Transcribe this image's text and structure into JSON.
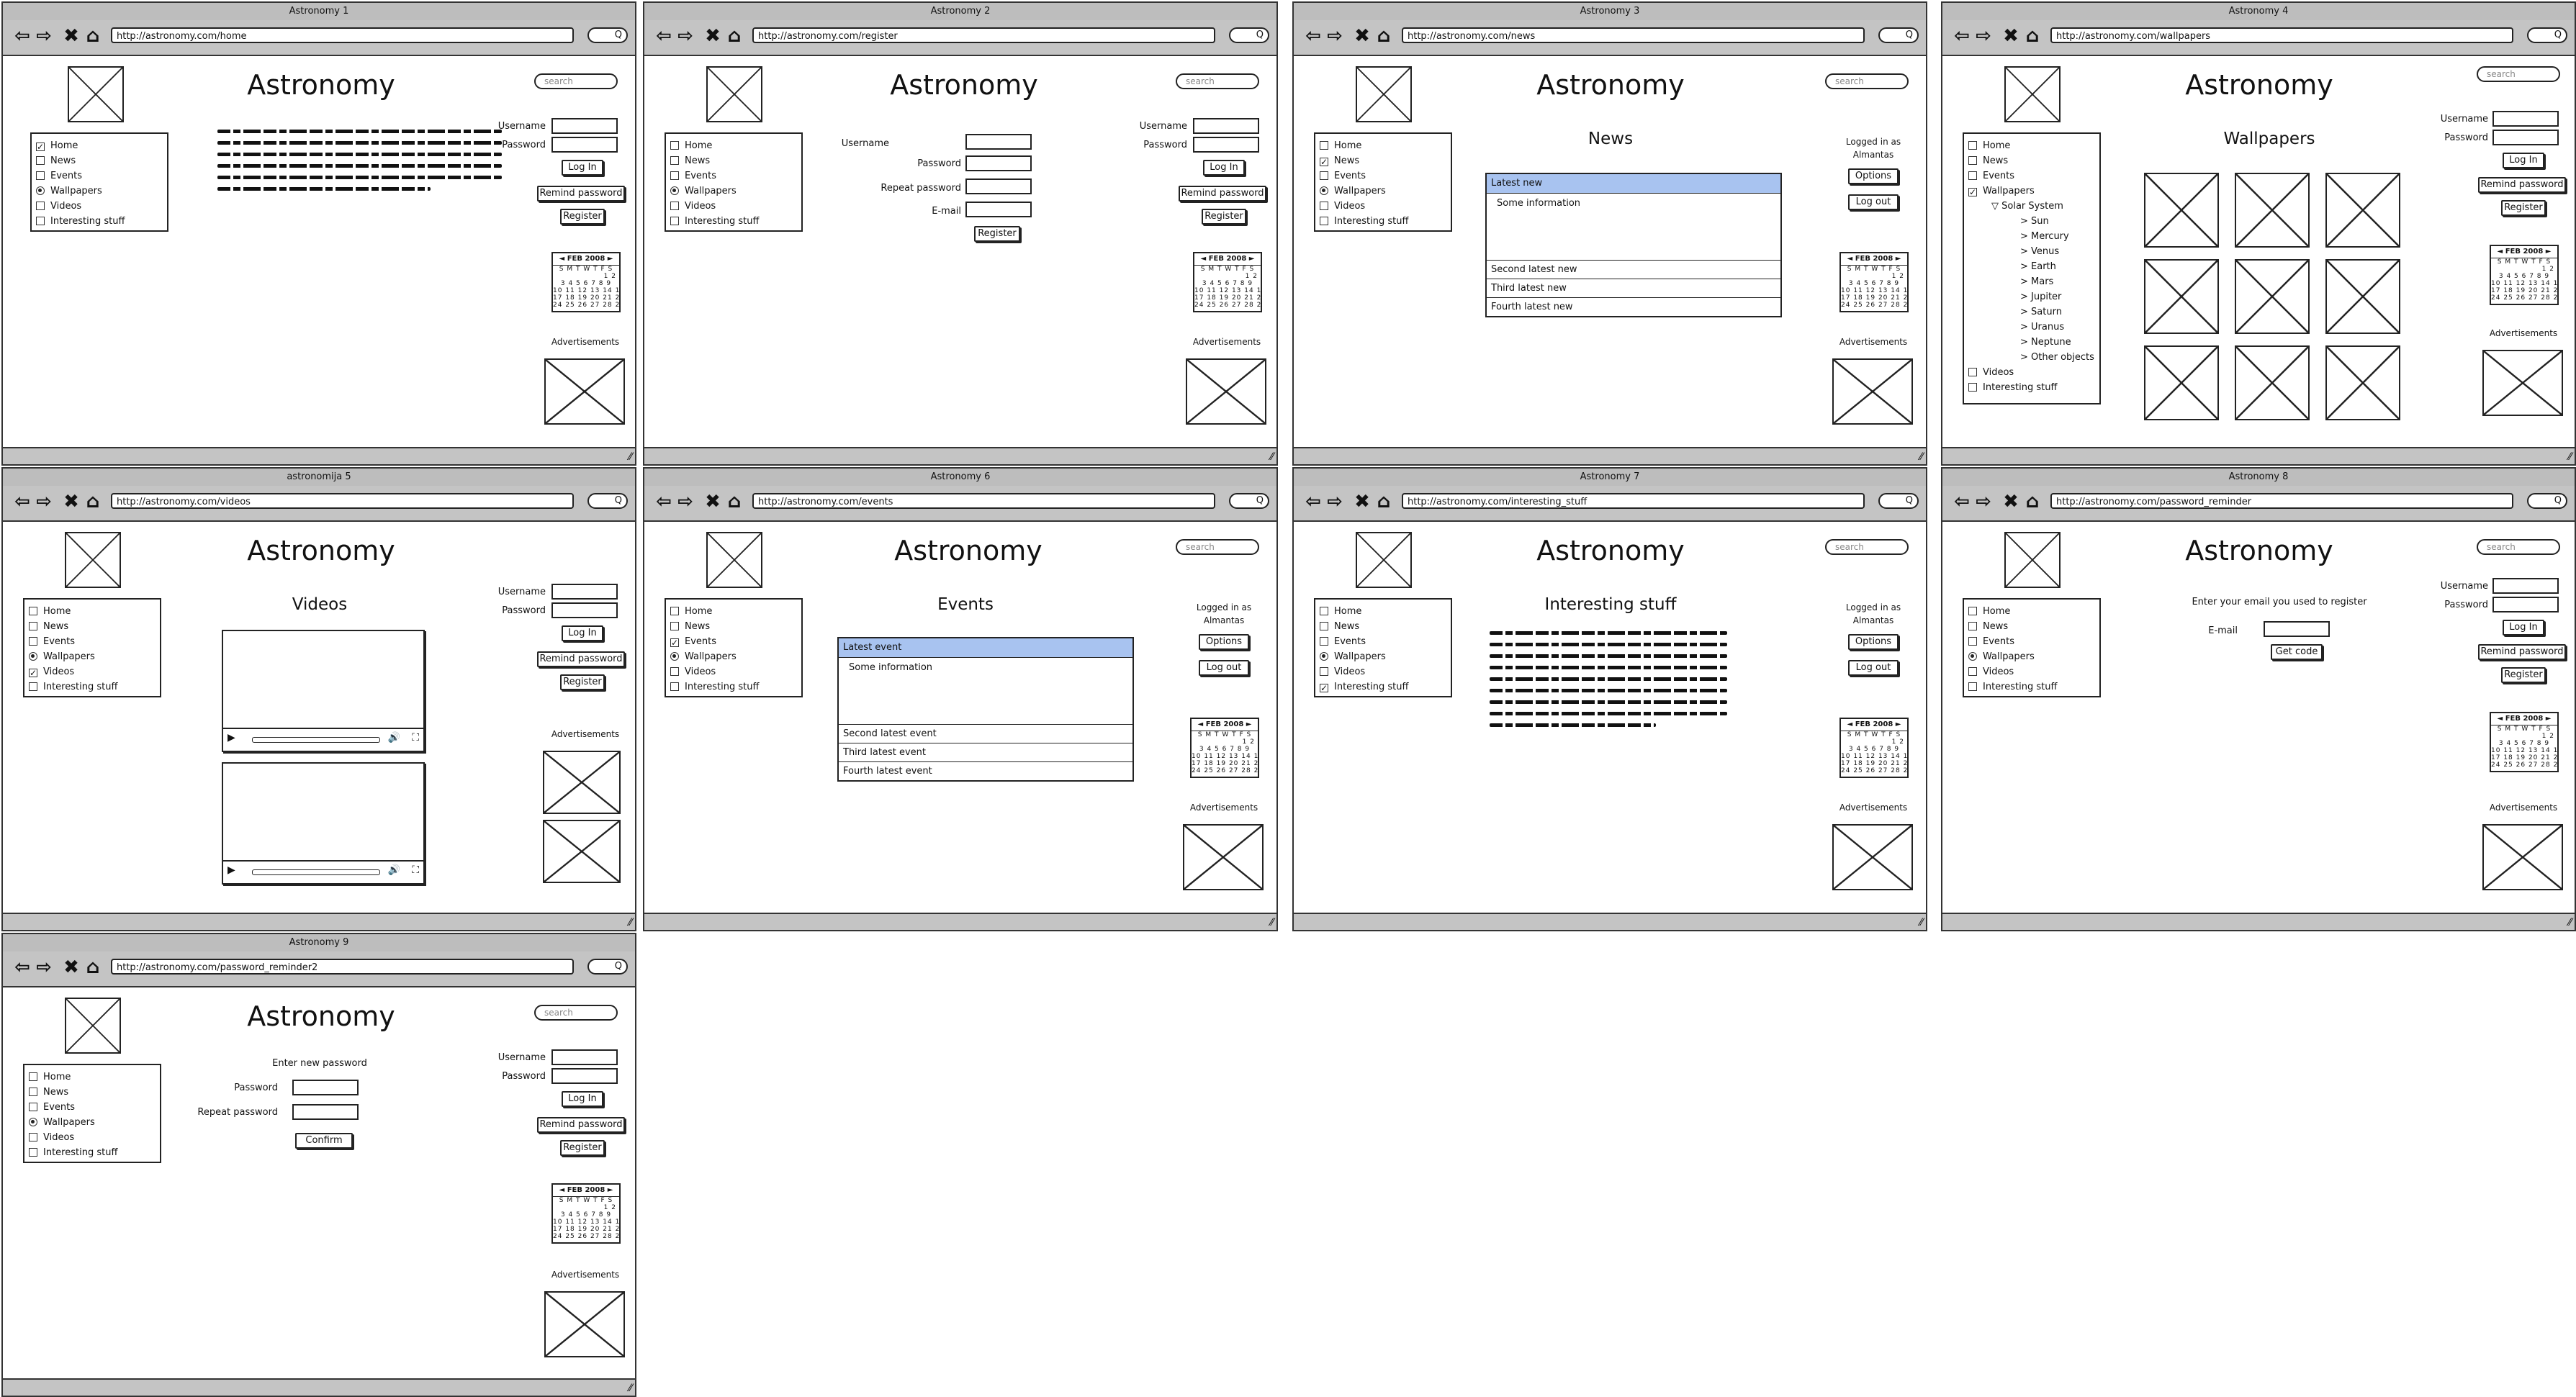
{
  "common": {
    "site_title": "Astronomy",
    "search_placeholder": "search",
    "browser_search": "Q",
    "username_label": "Username",
    "password_label": "Password",
    "login_label": "Log In",
    "remind_label": "Remind password",
    "register_label": "Register",
    "ads_label": "Advertisements",
    "logged_in_as": "Logged in as",
    "user_name": "Almantas",
    "options_label": "Options",
    "logout_label": "Log out",
    "calendar": {
      "header": "◄ FEB 2008 ►",
      "rows": [
        "S M T W T F S",
        "1 2",
        "3 4 5 6 7 8 9",
        "10 11 12 13 14 15 16",
        "17 18 19 20 21 22 23",
        "24 25 26 27 28 29"
      ]
    },
    "nav": [
      "Home",
      "News",
      "Events",
      "Wallpapers",
      "Videos",
      "Interesting stuff"
    ]
  },
  "windows": [
    {
      "title": "Astronomy 1",
      "url": "http://astronomy.com/home"
    },
    {
      "title": "Astronomy 2",
      "url": "http://astronomy.com/register",
      "form": {
        "username": "Username",
        "password": "Password",
        "repeat": "Repeat password",
        "email": "E-mail",
        "submit": "Register"
      }
    },
    {
      "title": "Astronomy 3",
      "url": "http://astronomy.com/news",
      "heading": "News",
      "list": {
        "selected": "Latest new",
        "body": "Some information",
        "rows": [
          "Second latest new",
          "Third latest new",
          "Fourth latest new"
        ]
      }
    },
    {
      "title": "Astronomy 4",
      "url": "http://astronomy.com/wallpapers",
      "heading": "Wallpapers",
      "tree": {
        "folder": "Solar System",
        "items": [
          "> Sun",
          "> Mercury",
          "> Venus",
          "> Earth",
          "> Mars",
          "> Jupiter",
          "> Saturn",
          "> Uranus",
          "> Neptune",
          "> Other objects"
        ]
      }
    },
    {
      "title": "astronomija 5",
      "url": "http://astronomy.com/videos",
      "heading": "Videos"
    },
    {
      "title": "Astronomy 6",
      "url": "http://astronomy.com/events",
      "heading": "Events",
      "list": {
        "selected": "Latest event",
        "body": "Some information",
        "rows": [
          "Second latest event",
          "Third latest event",
          "Fourth latest event"
        ]
      }
    },
    {
      "title": "Astronomy 7",
      "url": "http://astronomy.com/interesting_stuff",
      "heading": "Interesting stuff"
    },
    {
      "title": "Astronomy 8",
      "url": "http://astronomy.com/password_reminder",
      "form": {
        "prompt": "Enter your email you used to register",
        "email": "E-mail",
        "submit": "Get code"
      }
    },
    {
      "title": "Astronomy 9",
      "url": "http://astronomy.com/password_reminder2",
      "form": {
        "prompt": "Enter new password",
        "password": "Password",
        "repeat": "Repeat password",
        "submit": "Confirm"
      }
    }
  ]
}
